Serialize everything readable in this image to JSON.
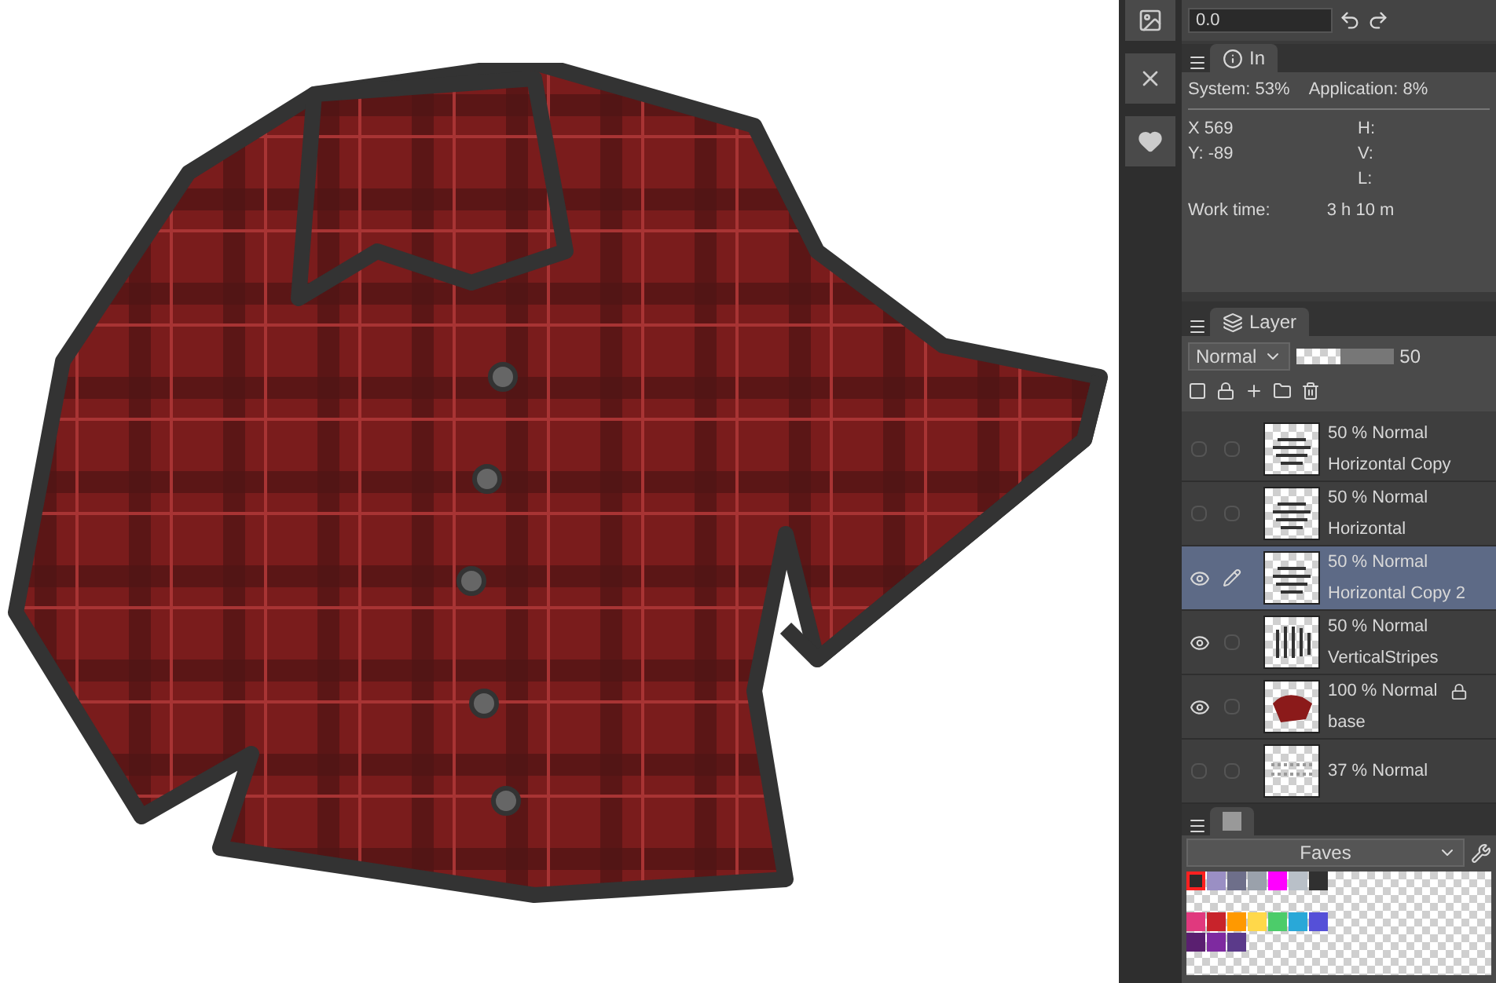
{
  "toolbar": {
    "value": "0.0"
  },
  "info_panel": {
    "tab": "In",
    "system": "System: 53%",
    "application": "Application:  8%",
    "x": "X  569",
    "y": "Y: -89",
    "h": "H:",
    "v": "V:",
    "l": "L:",
    "work_time_label": "Work time:",
    "work_time": "3 h 10 m"
  },
  "layer_panel": {
    "tab": "Layer",
    "blend_mode": "Normal",
    "opacity": {
      "level": 0.45,
      "reading": "50"
    },
    "layers": [
      {
        "mode": "50 % Normal",
        "name": "Horizontal Copy",
        "visible": false,
        "editing": false,
        "selected": false,
        "locked": false,
        "kind": "stripes"
      },
      {
        "mode": "50 % Normal",
        "name": "Horizontal",
        "visible": false,
        "editing": false,
        "selected": false,
        "locked": false,
        "kind": "stripes"
      },
      {
        "mode": "50 % Normal",
        "name": "Horizontal Copy 2",
        "visible": true,
        "editing": true,
        "selected": true,
        "locked": false,
        "kind": "stripes"
      },
      {
        "mode": "50 % Normal",
        "name": "VerticalStripes",
        "visible": true,
        "editing": false,
        "selected": false,
        "locked": false,
        "kind": "vertical"
      },
      {
        "mode": "100 % Normal",
        "name": "base",
        "visible": true,
        "editing": false,
        "selected": false,
        "locked": true,
        "kind": "fill"
      },
      {
        "mode": "37 % Normal",
        "visible": false,
        "editing": false,
        "selected": false,
        "locked": false,
        "kind": "texture"
      }
    ]
  },
  "palette": {
    "set": "Faves",
    "swatch_rows": [
      [
        {
          "color": "#2b2b2b",
          "selected": true
        },
        {
          "color": "#9a8fc4",
          "selected": false
        },
        {
          "color": "#6e6f8a",
          "selected": false
        },
        {
          "color": "#9aa1ab",
          "selected": false
        },
        {
          "color": "#ff00ff",
          "selected": false
        },
        {
          "color": "#b9c0c8",
          "selected": false
        },
        {
          "color": "#303030",
          "selected": false
        }
      ],
      [],
      [
        {
          "color": "#e0397e",
          "selected": false
        },
        {
          "color": "#c8232b",
          "selected": false
        },
        {
          "color": "#ff9900",
          "selected": false
        },
        {
          "color": "#ffd84a",
          "selected": false
        },
        {
          "color": "#4ccc6a",
          "selected": false
        },
        {
          "color": "#29a8d8",
          "selected": false
        },
        {
          "color": "#5550d8",
          "selected": false
        }
      ],
      [
        {
          "color": "#5a1f70",
          "selected": false
        },
        {
          "color": "#7e2aa0",
          "selected": false
        },
        {
          "color": "#5b3a8a",
          "selected": false
        }
      ]
    ]
  }
}
